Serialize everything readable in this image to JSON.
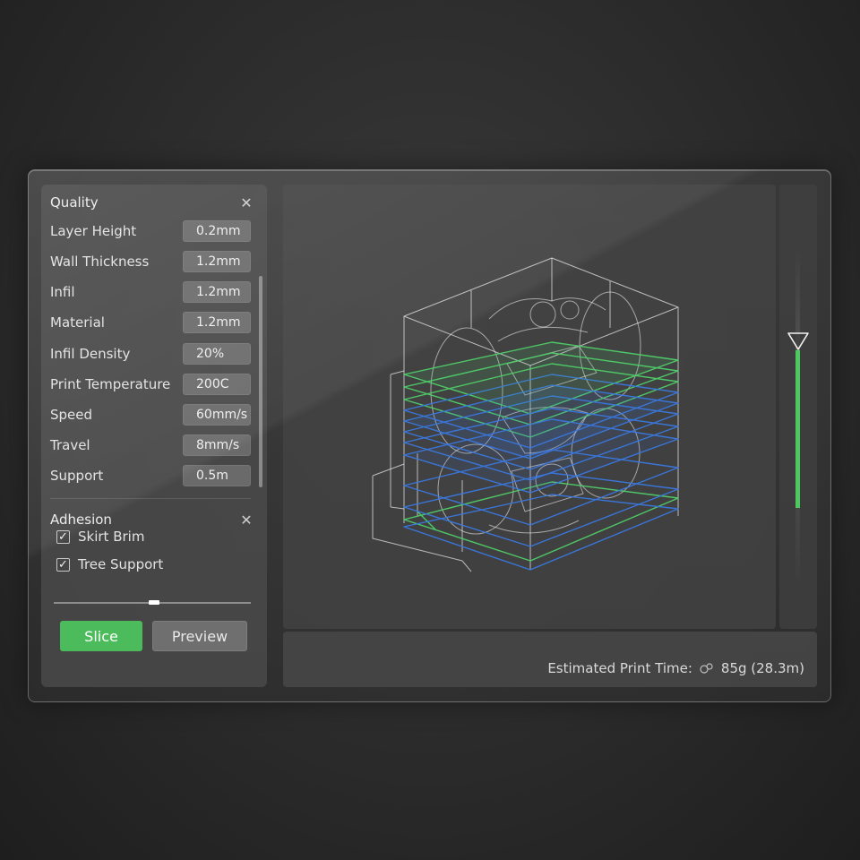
{
  "quality": {
    "title": "Quality",
    "rows": [
      {
        "label": "Layer Height",
        "value": "0.2mm"
      },
      {
        "label": "Wall Thickness",
        "value": "1.2mm"
      },
      {
        "label": "Infil",
        "value": "1.2mm"
      },
      {
        "label": "Material",
        "value": "1.2mm"
      },
      {
        "label": "Infil Density",
        "value": "20%"
      },
      {
        "label": "Print Temperature",
        "value": "200C"
      },
      {
        "label": "Speed",
        "value": "60mm/s"
      },
      {
        "label": "Travel",
        "value": "8mm/s"
      },
      {
        "label": "Support",
        "value": "0.5m"
      }
    ]
  },
  "adhesion": {
    "title": "Adhesion",
    "options": [
      {
        "label": "Skirt Brim",
        "checked": true
      },
      {
        "label": "Tree Support",
        "checked": true
      }
    ],
    "slider_value": 0.5
  },
  "buttons": {
    "slice": "Slice",
    "preview": "Preview"
  },
  "status": {
    "label": "Estimated Print Time:",
    "value": "85g (28.3m)"
  },
  "layer_slider": {
    "level": 0.6
  },
  "colors": {
    "accent_green": "#4cbb5c",
    "layer_blue": "#3a78e0",
    "layer_green": "#4fd06a"
  },
  "icons": {
    "close": "close-icon",
    "check": "check-icon",
    "filament": "filament-icon",
    "layer_handle": "triangle-down-icon"
  }
}
